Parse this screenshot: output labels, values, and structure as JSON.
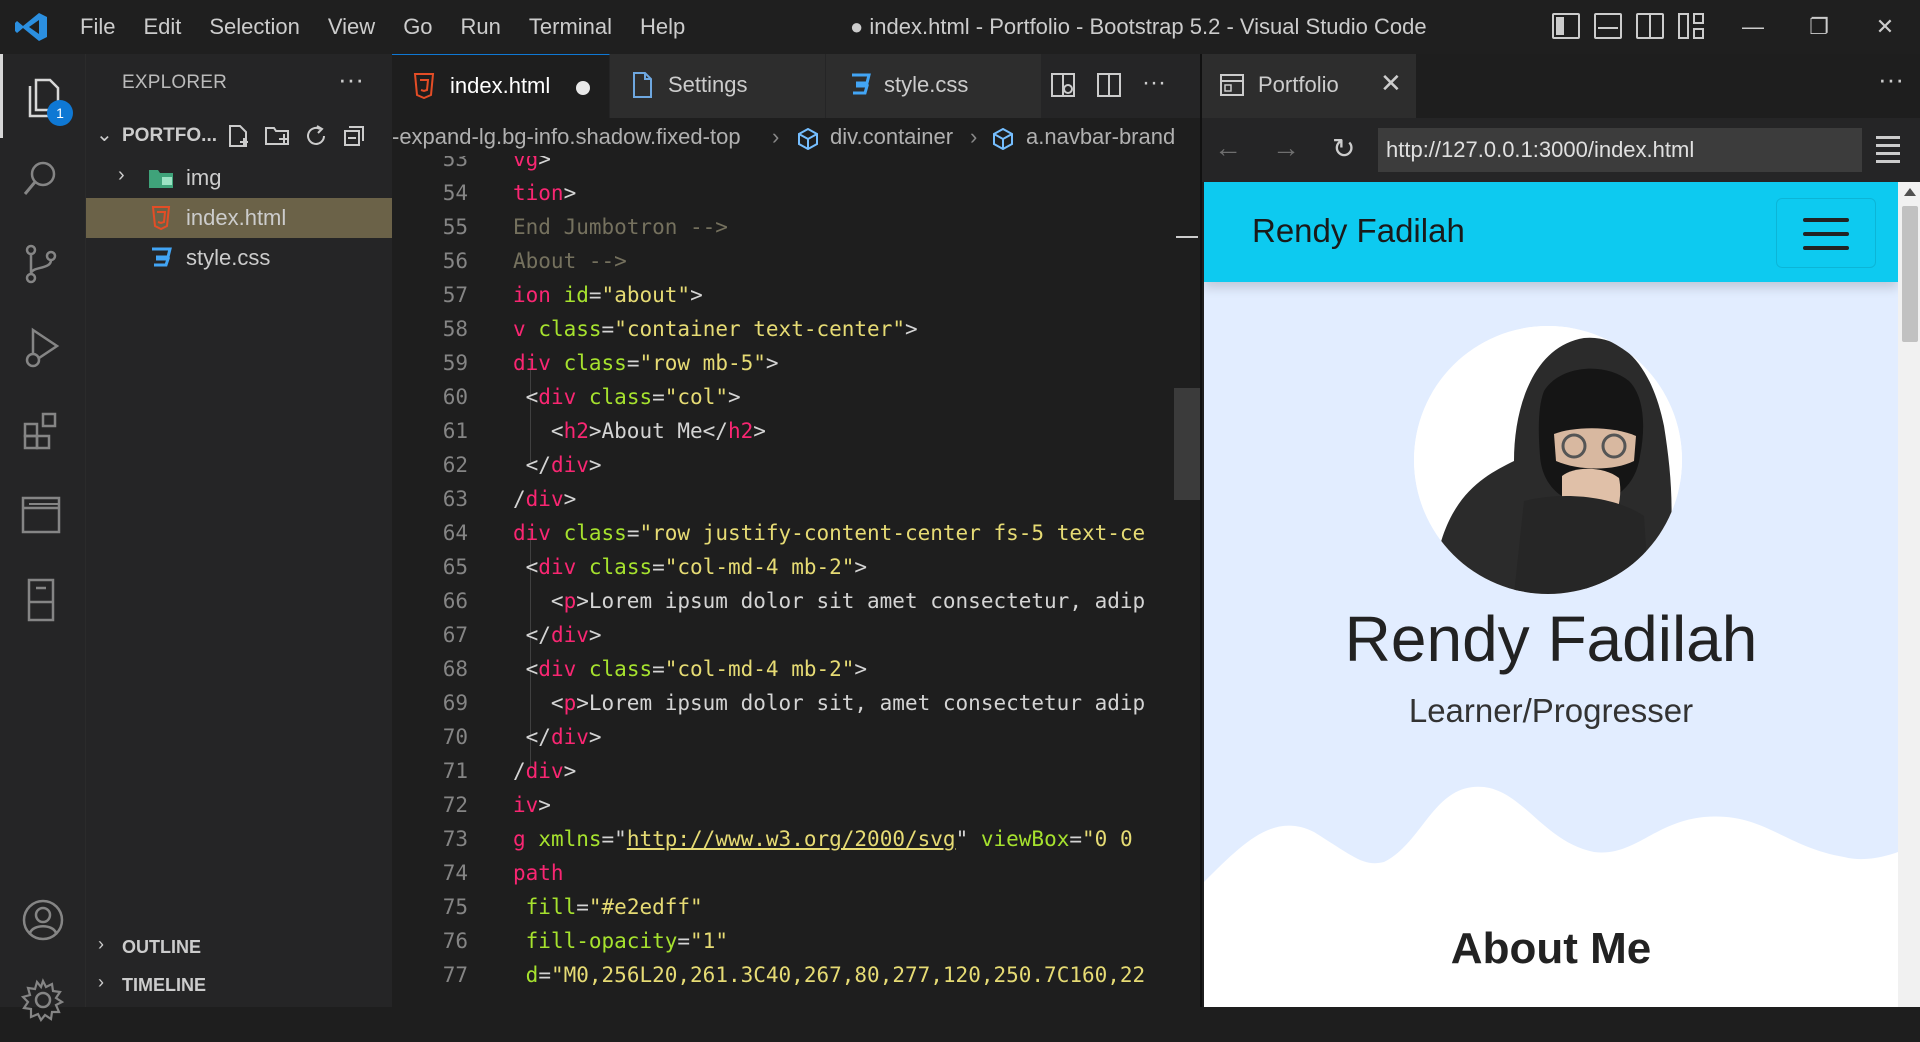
{
  "window": {
    "title": "● index.html - Portfolio - Bootstrap 5.2 - Visual Studio Code",
    "menu": [
      "File",
      "Edit",
      "Selection",
      "View",
      "Go",
      "Run",
      "Terminal",
      "Help"
    ],
    "controls": {
      "minimize": "—",
      "restore": "❐",
      "close": "✕"
    }
  },
  "activity_bar": {
    "items": [
      "explorer-icon",
      "search-icon",
      "source-control-icon",
      "run-debug-icon",
      "extensions-icon",
      "remote-explorer-icon",
      "bookmarks-icon",
      "accounts-icon",
      "manage-gear-icon"
    ],
    "explorer_badge": "1",
    "accent": "#0f78d4"
  },
  "sidebar": {
    "title": "EXPLORER",
    "more": "···",
    "folder": "PORTFO...",
    "tree": [
      {
        "label": "img",
        "type": "folder",
        "collapsed": true
      },
      {
        "label": "index.html",
        "type": "html",
        "selected": true
      },
      {
        "label": "style.css",
        "type": "css"
      }
    ],
    "sections": [
      "OUTLINE",
      "TIMELINE"
    ]
  },
  "editor": {
    "tabs": [
      {
        "label": "index.html",
        "active": true,
        "dirty": true
      },
      {
        "label": "Settings",
        "active": false
      },
      {
        "label": "style.css",
        "active": false
      }
    ],
    "breadcrumb": [
      "-expand-lg.bg-info.shadow.fixed-top",
      "div.container",
      "a.navbar-brand"
    ],
    "lines": [
      {
        "n": "53",
        "parts": [
          [
            "tg",
            "vg"
          ],
          [
            "pu",
            ">"
          ]
        ]
      },
      {
        "n": "54",
        "parts": [
          [
            "tg",
            "tion"
          ],
          [
            "pu",
            ">"
          ]
        ]
      },
      {
        "n": "55",
        "parts": [
          [
            "cm",
            "End Jumbotron -->"
          ]
        ]
      },
      {
        "n": "56",
        "parts": [
          [
            "cm",
            "About -->"
          ]
        ]
      },
      {
        "n": "57",
        "parts": [
          [
            "tg",
            "ion"
          ],
          [
            "pu",
            " "
          ],
          [
            "at",
            "id"
          ],
          [
            "pu",
            "="
          ],
          [
            "st",
            "\"about\""
          ],
          [
            "pu",
            ">"
          ]
        ]
      },
      {
        "n": "58",
        "parts": [
          [
            "tg",
            "v"
          ],
          [
            "pu",
            " "
          ],
          [
            "at",
            "class"
          ],
          [
            "pu",
            "="
          ],
          [
            "st",
            "\"container text-center\""
          ],
          [
            "pu",
            ">"
          ]
        ]
      },
      {
        "n": "59",
        "parts": [
          [
            "tg",
            "div"
          ],
          [
            "pu",
            " "
          ],
          [
            "at",
            "class"
          ],
          [
            "pu",
            "="
          ],
          [
            "st",
            "\"row mb-5\""
          ],
          [
            "pu",
            ">"
          ]
        ]
      },
      {
        "n": "60",
        "parts": [
          [
            "pu",
            " <"
          ],
          [
            "tg",
            "div"
          ],
          [
            "pu",
            " "
          ],
          [
            "at",
            "class"
          ],
          [
            "pu",
            "="
          ],
          [
            "st",
            "\"col\""
          ],
          [
            "pu",
            ">"
          ]
        ]
      },
      {
        "n": "61",
        "parts": [
          [
            "pu",
            "   <"
          ],
          [
            "tg",
            "h2"
          ],
          [
            "pu",
            ">About Me</"
          ],
          [
            "tg",
            "h2"
          ],
          [
            "pu",
            ">"
          ]
        ]
      },
      {
        "n": "62",
        "parts": [
          [
            "pu",
            " </"
          ],
          [
            "tg",
            "div"
          ],
          [
            "pu",
            ">"
          ]
        ]
      },
      {
        "n": "63",
        "parts": [
          [
            "pu",
            "/"
          ],
          [
            "tg",
            "div"
          ],
          [
            "pu",
            ">"
          ]
        ]
      },
      {
        "n": "64",
        "parts": [
          [
            "tg",
            "div"
          ],
          [
            "pu",
            " "
          ],
          [
            "at",
            "class"
          ],
          [
            "pu",
            "="
          ],
          [
            "st",
            "\"row justify-content-center fs-5 text-ce"
          ]
        ]
      },
      {
        "n": "65",
        "parts": [
          [
            "pu",
            " <"
          ],
          [
            "tg",
            "div"
          ],
          [
            "pu",
            " "
          ],
          [
            "at",
            "class"
          ],
          [
            "pu",
            "="
          ],
          [
            "st",
            "\"col-md-4 mb-2\""
          ],
          [
            "pu",
            ">"
          ]
        ]
      },
      {
        "n": "66",
        "parts": [
          [
            "pu",
            "   <"
          ],
          [
            "tg",
            "p"
          ],
          [
            "pu",
            ">Lorem ipsum dolor sit amet consectetur, adip"
          ]
        ]
      },
      {
        "n": "67",
        "parts": [
          [
            "pu",
            " </"
          ],
          [
            "tg",
            "div"
          ],
          [
            "pu",
            ">"
          ]
        ]
      },
      {
        "n": "68",
        "parts": [
          [
            "pu",
            " <"
          ],
          [
            "tg",
            "div"
          ],
          [
            "pu",
            " "
          ],
          [
            "at",
            "class"
          ],
          [
            "pu",
            "="
          ],
          [
            "st",
            "\"col-md-4 mb-2\""
          ],
          [
            "pu",
            ">"
          ]
        ]
      },
      {
        "n": "69",
        "parts": [
          [
            "pu",
            "   <"
          ],
          [
            "tg",
            "p"
          ],
          [
            "pu",
            ">Lorem ipsum dolor sit, amet consectetur adip"
          ]
        ]
      },
      {
        "n": "70",
        "parts": [
          [
            "pu",
            " </"
          ],
          [
            "tg",
            "div"
          ],
          [
            "pu",
            ">"
          ]
        ]
      },
      {
        "n": "71",
        "parts": [
          [
            "pu",
            "/"
          ],
          [
            "tg",
            "div"
          ],
          [
            "pu",
            ">"
          ]
        ]
      },
      {
        "n": "72",
        "parts": [
          [
            "tg",
            "iv"
          ],
          [
            "pu",
            ">"
          ]
        ]
      },
      {
        "n": "73",
        "parts": [
          [
            "tg",
            "g"
          ],
          [
            "pu",
            " "
          ],
          [
            "at",
            "xmlns"
          ],
          [
            "pu",
            "=\""
          ],
          [
            "lk",
            "http://www.w3.org/2000/svg"
          ],
          [
            "pu",
            "\" "
          ],
          [
            "at",
            "viewBox"
          ],
          [
            "pu",
            "="
          ],
          [
            "st",
            "\"0 0"
          ]
        ]
      },
      {
        "n": "74",
        "parts": [
          [
            "tg",
            "path"
          ]
        ]
      },
      {
        "n": "75",
        "parts": [
          [
            "pu",
            " "
          ],
          [
            "at",
            "fill"
          ],
          [
            "pu",
            "="
          ],
          [
            "st",
            "\"#e2edff\""
          ]
        ]
      },
      {
        "n": "76",
        "parts": [
          [
            "pu",
            " "
          ],
          [
            "at",
            "fill-opacity"
          ],
          [
            "pu",
            "="
          ],
          [
            "st",
            "\"1\""
          ]
        ]
      },
      {
        "n": "77",
        "parts": [
          [
            "pu",
            " "
          ],
          [
            "at",
            "d"
          ],
          [
            "pu",
            "="
          ],
          [
            "st",
            "\"M0,256L20,261.3C40,267,80,277,120,250.7C160,22"
          ]
        ]
      }
    ]
  },
  "browser": {
    "tab_label": "Portfolio",
    "tab_close": "✕",
    "more": "···",
    "back": "←",
    "forward": "→",
    "reload": "↻",
    "url": "http://127.0.0.1:3000/index.html",
    "page": {
      "brand": "Rendy Fadilah",
      "nav_color": "#0dcaf0",
      "hero_name": "Rendy Fadilah",
      "hero_subtitle": "Learner/Progresser",
      "section_title": "About Me",
      "bg_color": "#e2edff"
    }
  }
}
